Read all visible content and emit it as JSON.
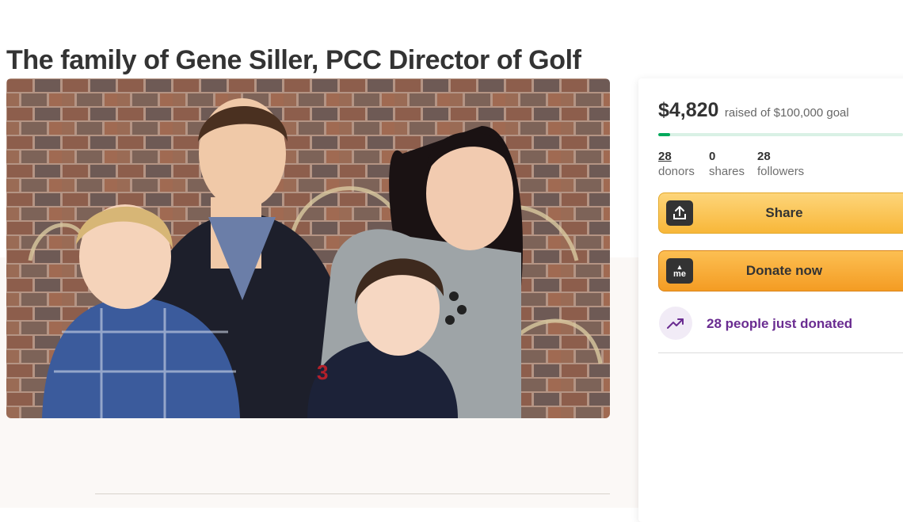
{
  "page": {
    "title": "The family of Gene Siller, PCC Director of Golf"
  },
  "photo": {
    "alt_description": "family-photo"
  },
  "donation": {
    "amount_raised": "$4,820",
    "goal_text": "raised of $100,000 goal",
    "progress_fraction": 0.048,
    "stats": [
      {
        "value": "28",
        "label": "donors"
      },
      {
        "value": "0",
        "label": "shares"
      },
      {
        "value": "28",
        "label": "followers"
      }
    ],
    "share_button": {
      "label": "Share",
      "icon": "share-upload-icon"
    },
    "donate_button": {
      "label": "Donate now",
      "icon": "gofundme-logo-icon",
      "icon_text": "me"
    },
    "activity": {
      "text": "28 people just donated",
      "icon": "trending-up-icon"
    }
  },
  "colors": {
    "progress_green": "#02a95c",
    "share_yellow": "#f8b739",
    "donate_orange": "#f49c23",
    "activity_purple": "#6a2c91"
  }
}
